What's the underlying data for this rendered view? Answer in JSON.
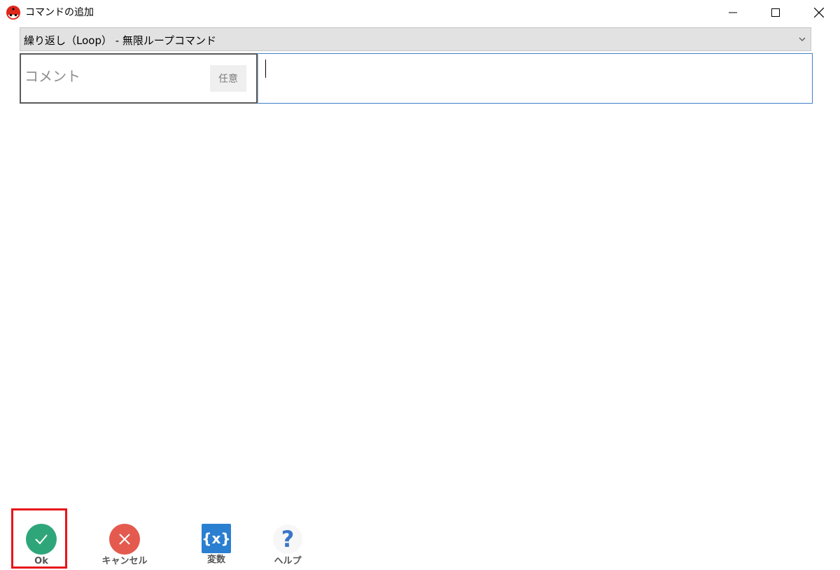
{
  "window": {
    "title": "コマンドの追加",
    "app_icon": "ladybug-icon"
  },
  "command_select": {
    "value": "繰り返し（Loop） - 無限ループコマンド",
    "icon": "chevron-down-icon"
  },
  "comment": {
    "label": "コメント",
    "badge": "任意",
    "value": ""
  },
  "footer": {
    "ok_label": "Ok",
    "cancel_label": "キャンセル",
    "variables_label": "変数",
    "variables_icon_text": "{x}",
    "help_label": "ヘルプ",
    "help_icon_text": "?"
  },
  "colors": {
    "ok": "#2fa67a",
    "cancel": "#e45a4e",
    "variables": "#2a7fd1",
    "help": "#3a76c9",
    "highlight": "#e8141a"
  }
}
